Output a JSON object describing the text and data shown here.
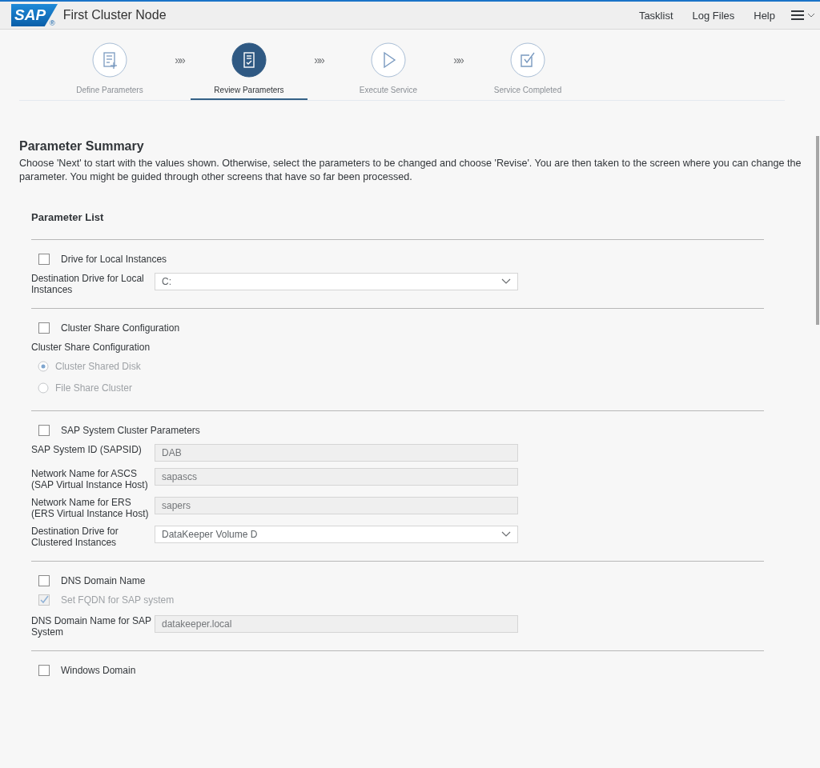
{
  "header": {
    "logo": "SAP",
    "registered": "®",
    "title": "First Cluster Node",
    "links": [
      "Tasklist",
      "Log Files",
      "Help"
    ]
  },
  "steps": [
    {
      "label": "Define Parameters",
      "selected": false
    },
    {
      "label": "Review Parameters",
      "selected": true
    },
    {
      "label": "Execute Service",
      "selected": false
    },
    {
      "label": "Service Completed",
      "selected": false
    }
  ],
  "step_separator": "»»",
  "summary": {
    "title": "Parameter Summary",
    "text": "Choose 'Next' to start with the values shown. Otherwise, select the parameters to be changed and choose 'Revise'. You are then taken to the screen where you can change the parameter. You might be guided through other screens that have so far been processed."
  },
  "parameter_list": {
    "title": "Parameter List",
    "sections": [
      {
        "label": "Drive for Local Instances",
        "checked": false,
        "fields": [
          {
            "kind": "select",
            "label": "Destination Drive for Local Instances",
            "value": "C:"
          }
        ]
      },
      {
        "label": "Cluster Share Configuration",
        "checked": false,
        "fields": [
          {
            "kind": "heading",
            "label": "Cluster Share Configuration"
          },
          {
            "kind": "radio",
            "label": "Cluster Shared Disk",
            "selected": true,
            "disabled": true
          },
          {
            "kind": "radio",
            "label": "File Share Cluster",
            "selected": false,
            "disabled": true
          }
        ]
      },
      {
        "label": "SAP System Cluster Parameters",
        "checked": false,
        "fields": [
          {
            "kind": "input",
            "label": "SAP System ID (SAPSID)",
            "value": "DAB",
            "disabled": true
          },
          {
            "kind": "input",
            "label": "Network Name for ASCS (SAP Virtual Instance Host)",
            "value": "sapascs",
            "disabled": true
          },
          {
            "kind": "input",
            "label": "Network Name for ERS (ERS Virtual Instance Host)",
            "value": "sapers",
            "disabled": true
          },
          {
            "kind": "select",
            "label": "Destination Drive for Clustered Instances",
            "value": "DataKeeper Volume D"
          }
        ]
      },
      {
        "label": "DNS Domain Name",
        "checked": false,
        "fields": [
          {
            "kind": "checkbox",
            "label": "Set FQDN for SAP system",
            "checked": true,
            "disabled": true
          },
          {
            "kind": "input",
            "label": "DNS Domain Name for SAP System",
            "value": "datakeeper.local",
            "disabled": true
          }
        ]
      },
      {
        "label": "Windows Domain",
        "checked": false
      }
    ]
  }
}
